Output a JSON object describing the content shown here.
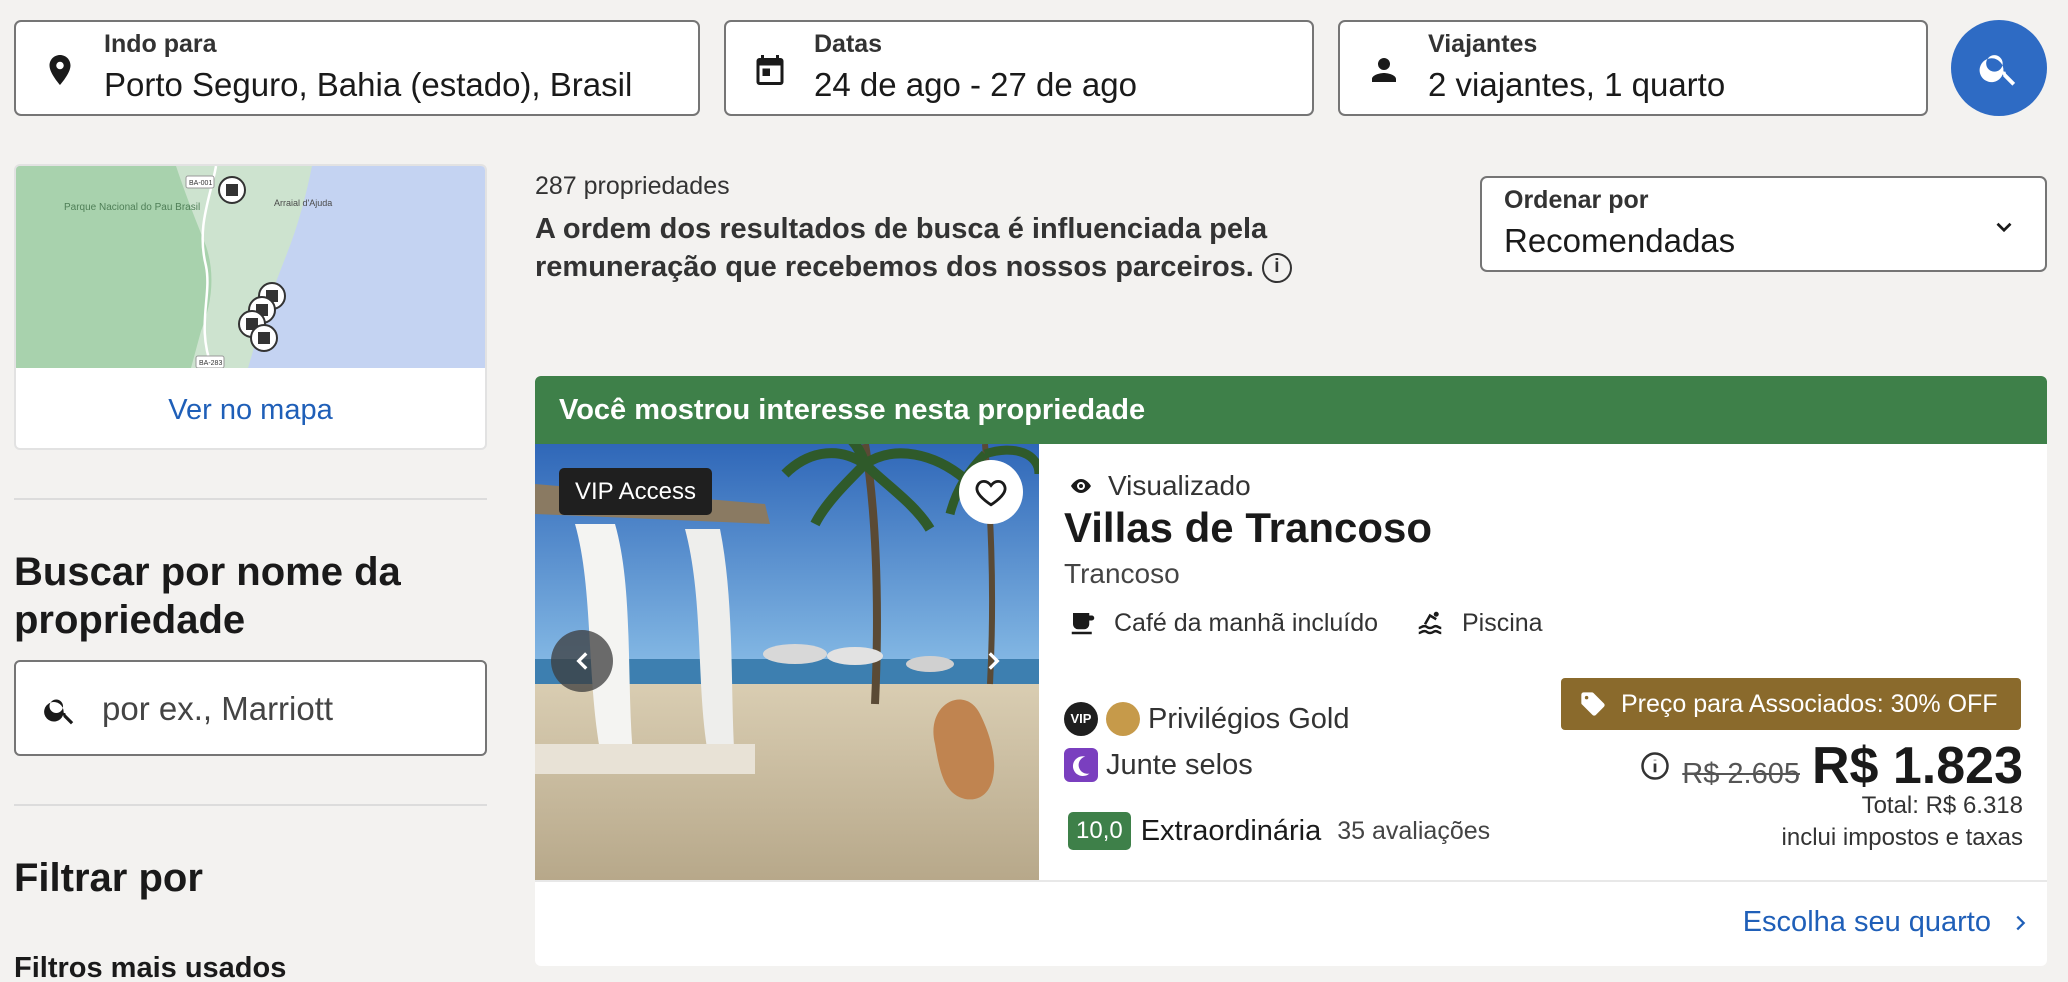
{
  "search": {
    "destination": {
      "label": "Indo para",
      "value": "Porto Seguro, Bahia (estado), Brasil",
      "icon": "location-pin-icon"
    },
    "dates": {
      "label": "Datas",
      "value": "24 de ago - 27 de ago",
      "icon": "calendar-icon"
    },
    "travelers": {
      "label": "Viajantes",
      "value": "2 viajantes, 1 quarto",
      "icon": "person-icon"
    },
    "submit_icon": "search-icon"
  },
  "map": {
    "labels": {
      "park": "Parque Nacional do Pau Brasil",
      "town": "Arraial d'Ajuda",
      "road1": "BA-001",
      "road2": "BA-283"
    },
    "link": "Ver no mapa"
  },
  "sidebar": {
    "name_search_title": "Buscar por nome da propriedade",
    "name_search_placeholder": "por ex., Marriott",
    "filter_title": "Filtrar por",
    "filter_subtitle": "Filtros mais usados"
  },
  "results": {
    "count": "287 propriedades",
    "disclaimer": "A ordem dos resultados de busca é influenciada pela remuneração que recebemos dos nossos parceiros.",
    "sort": {
      "label": "Ordenar por",
      "value": "Recomendadas"
    }
  },
  "listing": {
    "banner": "Você mostrou interesse nesta propriedade",
    "vip_badge": "VIP Access",
    "viewed": "Visualizado",
    "name": "Villas de Trancoso",
    "location": "Trancoso",
    "amenities": [
      "Café da manhã incluído",
      "Piscina"
    ],
    "loyalty": {
      "vip_mark": "VIP",
      "tier": "Privilégios Gold",
      "stamps": "Junte selos"
    },
    "rating": {
      "score": "10,0",
      "word": "Extraordinária",
      "reviews": "35 avaliações"
    },
    "promo": "Preço para Associados: 30% OFF",
    "old_price": "R$ 2.605",
    "price": "R$ 1.823",
    "total": "Total: R$ 6.318",
    "taxes": "inclui impostos e taxas",
    "cta": "Escolha seu quarto"
  },
  "colors": {
    "accent": "#2e6bc4",
    "link": "#1f5fb8",
    "banner_green": "#3e8049",
    "promo_gold": "#8a6a2c"
  }
}
